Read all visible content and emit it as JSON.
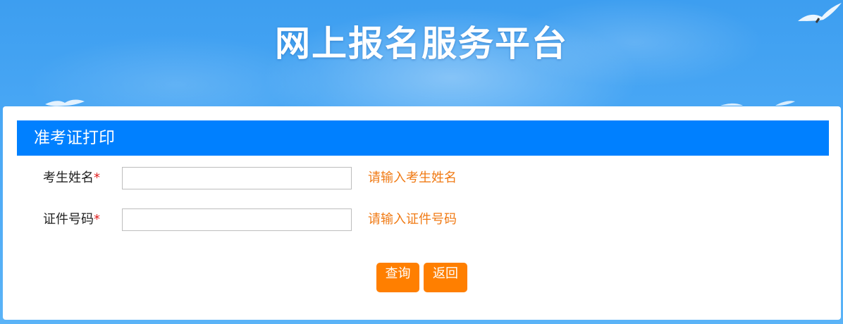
{
  "header": {
    "site_title": "网上报名服务平台"
  },
  "panel": {
    "title": "准考证打印",
    "fields": [
      {
        "label": "考生姓名",
        "required_mark": "*",
        "value": "",
        "hint": "请输入考生姓名"
      },
      {
        "label": "证件号码",
        "required_mark": "*",
        "value": "",
        "hint": "请输入证件号码"
      }
    ],
    "buttons": {
      "query": "查询",
      "back": "返回"
    }
  },
  "colors": {
    "panel_header": "#0080ff",
    "button": "#ff7f00",
    "hint_text": "#f07a14",
    "required": "#e02020"
  }
}
